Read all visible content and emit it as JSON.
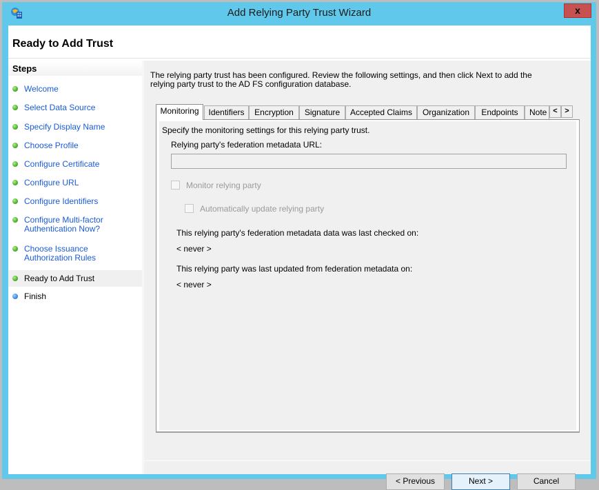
{
  "window": {
    "title": "Add Relying Party Trust Wizard",
    "close_label": "x"
  },
  "page": {
    "title": "Ready to Add Trust"
  },
  "steps": {
    "title": "Steps",
    "items": [
      {
        "label": "Welcome",
        "status": "done"
      },
      {
        "label": "Select Data Source",
        "status": "done"
      },
      {
        "label": "Specify Display Name",
        "status": "done"
      },
      {
        "label": "Choose Profile",
        "status": "done"
      },
      {
        "label": "Configure Certificate",
        "status": "done"
      },
      {
        "label": "Configure URL",
        "status": "done"
      },
      {
        "label": "Configure Identifiers",
        "status": "done"
      },
      {
        "label": "Configure Multi-factor Authentication Now?",
        "line1": "Configure Multi-factor",
        "line2": "Authentication Now?",
        "status": "done"
      },
      {
        "label": "Choose Issuance Authorization Rules",
        "line1": "Choose Issuance",
        "line2": "Authorization Rules",
        "status": "done"
      },
      {
        "label": "Ready to Add Trust",
        "status": "current"
      },
      {
        "label": "Finish",
        "status": "pending"
      }
    ]
  },
  "intro": {
    "line1": "The relying party trust has been configured. Review the following settings, and then click Next to add the",
    "line2": "relying party trust to the AD FS configuration database."
  },
  "tabs": {
    "items": [
      "Monitoring",
      "Identifiers",
      "Encryption",
      "Signature",
      "Accepted Claims",
      "Organization",
      "Endpoints",
      "Note"
    ],
    "active": "Monitoring",
    "scroll_left": "<",
    "scroll_right": ">"
  },
  "monitoring": {
    "description": "Specify the monitoring settings for this relying party trust.",
    "url_label": "Relying party's federation metadata URL:",
    "url_value": "",
    "monitor_label": "Monitor relying party",
    "monitor_checked": false,
    "auto_update_label": "Automatically update relying party",
    "auto_update_checked": false,
    "last_checked_label": "This relying party's federation metadata data was last checked on:",
    "last_checked_value": "< never >",
    "last_updated_label": "This relying party was last updated from federation metadata on:",
    "last_updated_value": "< never >"
  },
  "buttons": {
    "previous": "< Previous",
    "next": "Next >",
    "cancel": "Cancel"
  }
}
